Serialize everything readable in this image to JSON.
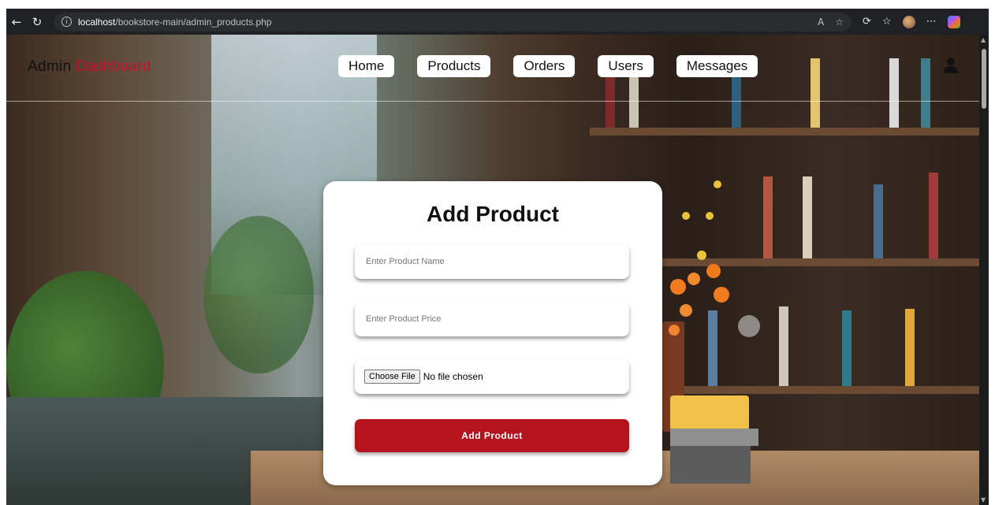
{
  "browser": {
    "back_icon": "arrow-left-icon",
    "refresh_icon": "refresh-icon",
    "url_host": "localhost",
    "url_path": "/bookstore-main/admin_products.php"
  },
  "header": {
    "logo_primary": "Admin ",
    "logo_accent": "Dashboard",
    "accent_color": "#c8102e",
    "nav": [
      "Home",
      "Products",
      "Orders",
      "Users",
      "Messages"
    ],
    "user_icon": "user-icon"
  },
  "form": {
    "title": "Add Product",
    "name_placeholder": "Enter Product Name",
    "price_placeholder": "Enter Product Price",
    "file_button": "Choose File",
    "file_status": "No file chosen",
    "submit_label": "Add Product",
    "submit_color": "#b5141f"
  }
}
